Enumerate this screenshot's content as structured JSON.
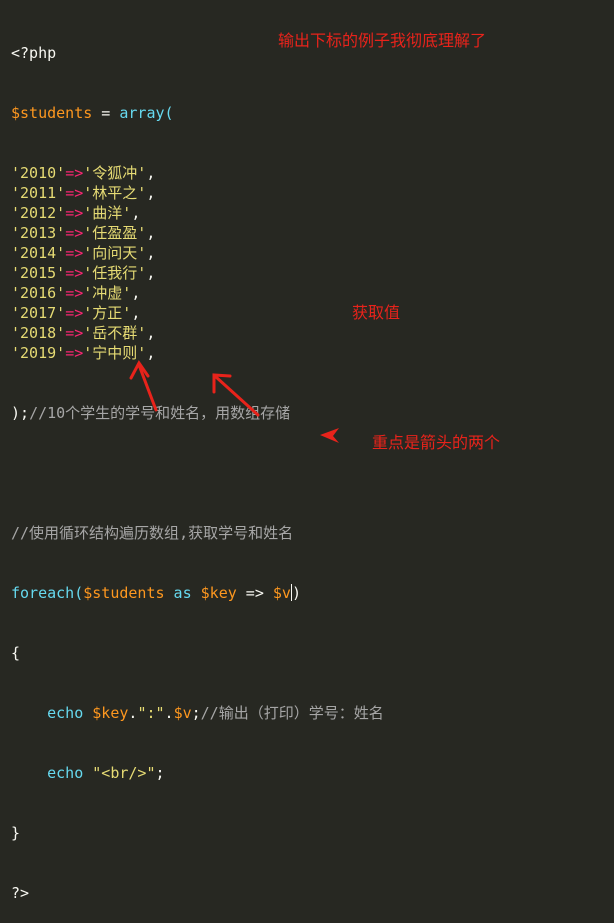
{
  "code": {
    "open_tag": "<?php",
    "students_var": "$students",
    "assign": " = ",
    "array_kw": "array(",
    "entries": [
      {
        "key": "'2010'",
        "arrow": "=>",
        "val": "'令狐冲'",
        "comma": ","
      },
      {
        "key": "'2011'",
        "arrow": "=>",
        "val": "'林平之'",
        "comma": ","
      },
      {
        "key": "'2012'",
        "arrow": "=>",
        "val": "'曲洋'",
        "comma": ","
      },
      {
        "key": "'2013'",
        "arrow": "=>",
        "val": "'任盈盈'",
        "comma": ","
      },
      {
        "key": "'2014'",
        "arrow": "=>",
        "val": "'向问天'",
        "comma": ","
      },
      {
        "key": "'2015'",
        "arrow": "=>",
        "val": "'任我行'",
        "comma": ","
      },
      {
        "key": "'2016'",
        "arrow": "=>",
        "val": "'冲虚'",
        "comma": ","
      },
      {
        "key": "'2017'",
        "arrow": "=>",
        "val": "'方正'",
        "comma": ","
      },
      {
        "key": "'2018'",
        "arrow": "=>",
        "val": "'岳不群'",
        "comma": ","
      },
      {
        "key": "'2019'",
        "arrow": "=>",
        "val": "'宁中则'",
        "comma": ","
      }
    ],
    "array_close": ");",
    "array_comment": "//10个学生的学号和姓名，用数组存储",
    "loop_comment": "//使用循环结构遍历数组,获取学号和姓名",
    "foreach_kw": "foreach(",
    "foreach_var": "$students",
    "as_kw": " as ",
    "key_var": "$key",
    "double_arrow": " => ",
    "value_var": "$v",
    "foreach_close": ")",
    "brace_open": "{",
    "echo_kw": "echo ",
    "echo1_key": "$key",
    "echo1_dot1": ".",
    "echo1_sep": "\":\"",
    "echo1_dot2": ".",
    "echo1_v": "$v",
    "echo1_semi": ";",
    "echo1_comment": "//输出（打印）学号：姓名",
    "echo2_str": "\"<br/>\"",
    "echo2_semi": ";",
    "brace_close": "}",
    "close_tag": "?>"
  },
  "annotations": {
    "top_note": "输出下标的例子我彻底理解了",
    "value_note": "获取值",
    "arrow_note": "重点是箭头的两个"
  },
  "colors": {
    "background": "#272822",
    "keyword": "#66d9ef",
    "variable": "#fd971f",
    "string": "#e6db74",
    "comment": "#a6a6a6",
    "annotation": "#e8231b"
  }
}
